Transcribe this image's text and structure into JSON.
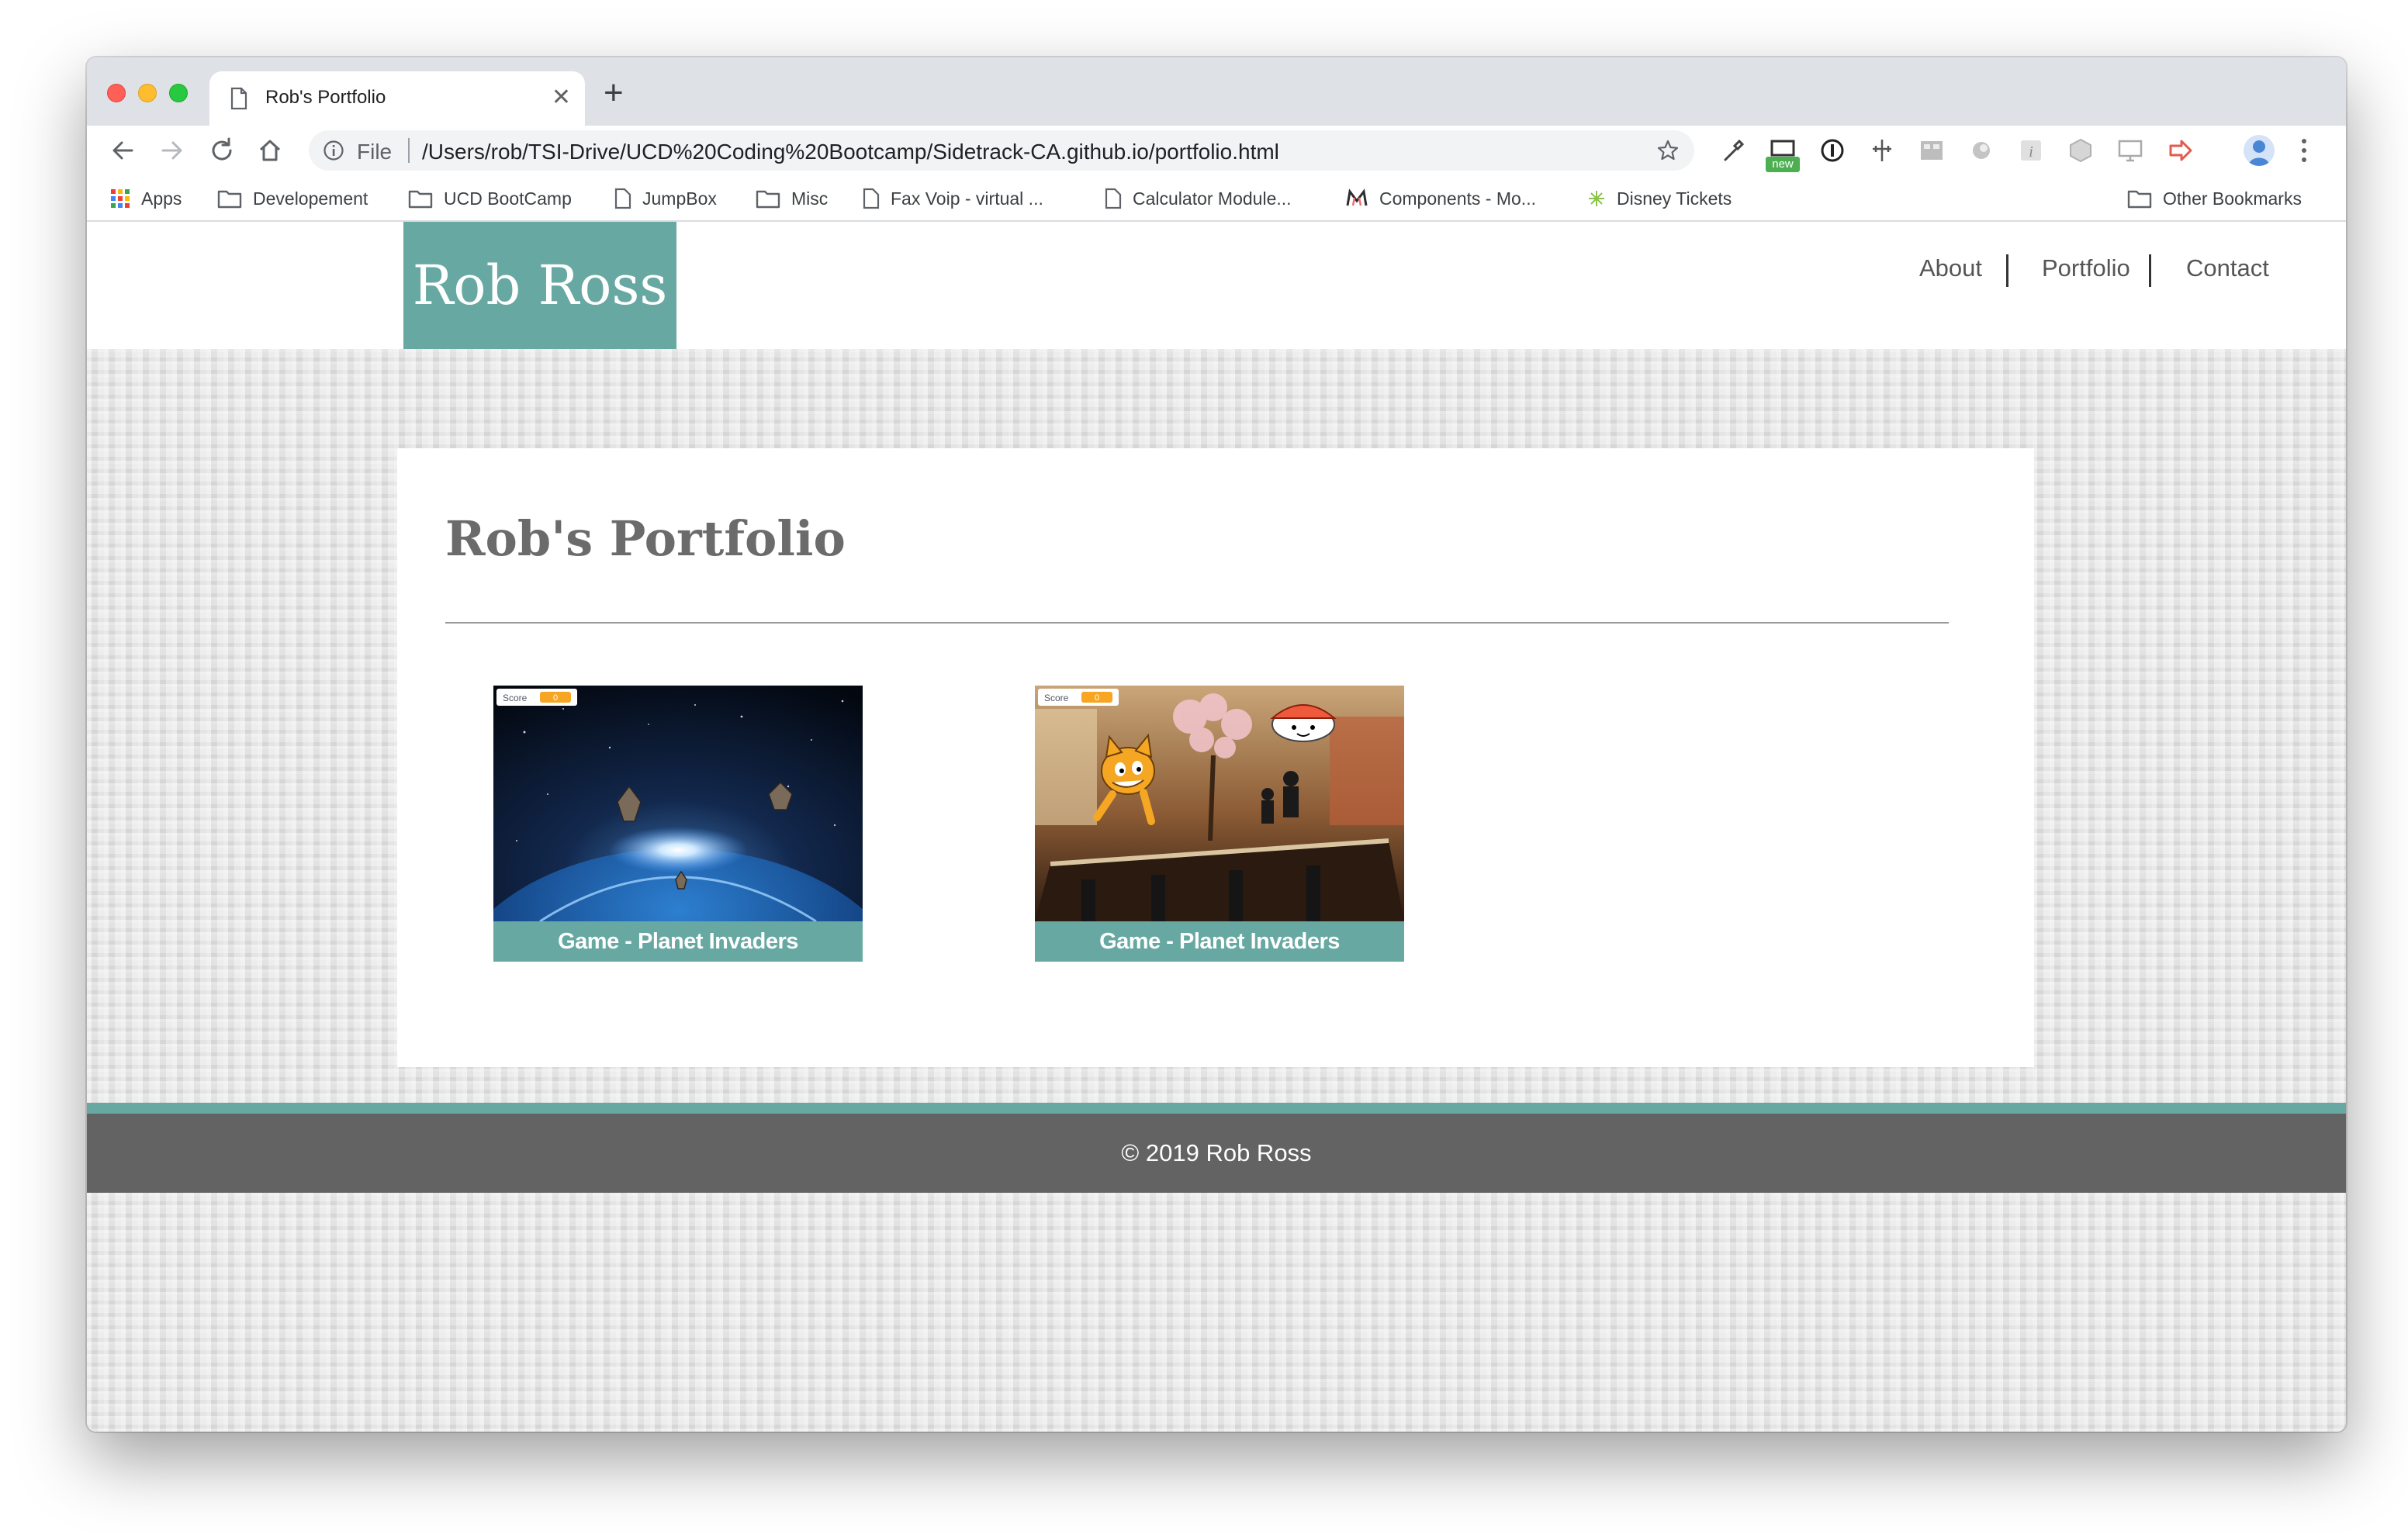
{
  "browser": {
    "tab_title": "Rob's Portfolio",
    "omnibox_scheme": "File",
    "url": "/Users/rob/TSI-Drive/UCD%20Coding%20Bootcamp/Sidetrack-CA.github.io/portfolio.html",
    "extension_badge": "new"
  },
  "bookmarks": {
    "items": [
      {
        "label": "Apps",
        "icon": "apps-grid-icon"
      },
      {
        "label": "Developement",
        "icon": "folder-icon"
      },
      {
        "label": "UCD BootCamp",
        "icon": "folder-icon"
      },
      {
        "label": "JumpBox",
        "icon": "page-icon"
      },
      {
        "label": "Misc",
        "icon": "folder-icon"
      },
      {
        "label": "Fax Voip - virtual ...",
        "icon": "page-icon"
      },
      {
        "label": "Calculator Module...",
        "icon": "page-icon"
      },
      {
        "label": "Components - Mo...",
        "icon": "materialize-icon"
      },
      {
        "label": "Disney Tickets",
        "icon": "sparkle-icon"
      }
    ],
    "other": "Other Bookmarks"
  },
  "site": {
    "logo": "Rob Ross",
    "nav": [
      "About",
      "Portfolio",
      "Contact"
    ],
    "page_title": "Rob's Portfolio",
    "cards": [
      {
        "caption": "Game - Planet Invaders",
        "scene": "space",
        "hud_label": "Score",
        "hud_value": "0"
      },
      {
        "caption": "Game - Planet Invaders",
        "scene": "sushi",
        "hud_label": "Score",
        "hud_value": "0"
      }
    ],
    "footer": "© 2019 Rob Ross"
  },
  "colors": {
    "brand_teal": "#67a9a2",
    "footer_gray": "#636363",
    "title_gray": "#6b6b6b"
  }
}
